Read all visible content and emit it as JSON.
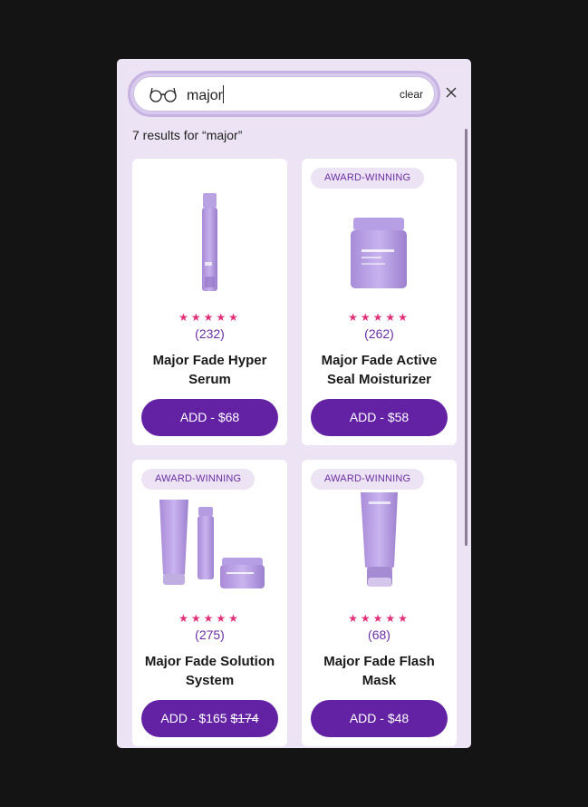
{
  "search": {
    "query": "major",
    "clear_label": "clear",
    "icon": "glasses-icon",
    "close_icon": "close-icon"
  },
  "results_label": "7 results for “major”",
  "colors": {
    "panel_bg": "#ece3f4",
    "accent": "#6321a3",
    "star": "#e0307a",
    "badge_text": "#6a2fa3"
  },
  "products": [
    {
      "name": "Major Fade Hyper Serum",
      "badge": "",
      "stars": "★★★★★",
      "reviews": "(232)",
      "add_label": "ADD - $68",
      "old_price": ""
    },
    {
      "name": "Major Fade Active Seal Moisturizer",
      "badge": "AWARD-WINNING",
      "stars": "★★★★★",
      "reviews": "(262)",
      "add_label": "ADD - $58",
      "old_price": ""
    },
    {
      "name": "Major Fade Solution System",
      "badge": "AWARD-WINNING",
      "stars": "★★★★★",
      "reviews": "(275)",
      "add_label": "ADD - $165",
      "old_price": "$174"
    },
    {
      "name": "Major Fade Flash Mask",
      "badge": "AWARD-WINNING",
      "stars": "★★★★★",
      "reviews": "(68)",
      "add_label": "ADD - $48",
      "old_price": ""
    }
  ]
}
